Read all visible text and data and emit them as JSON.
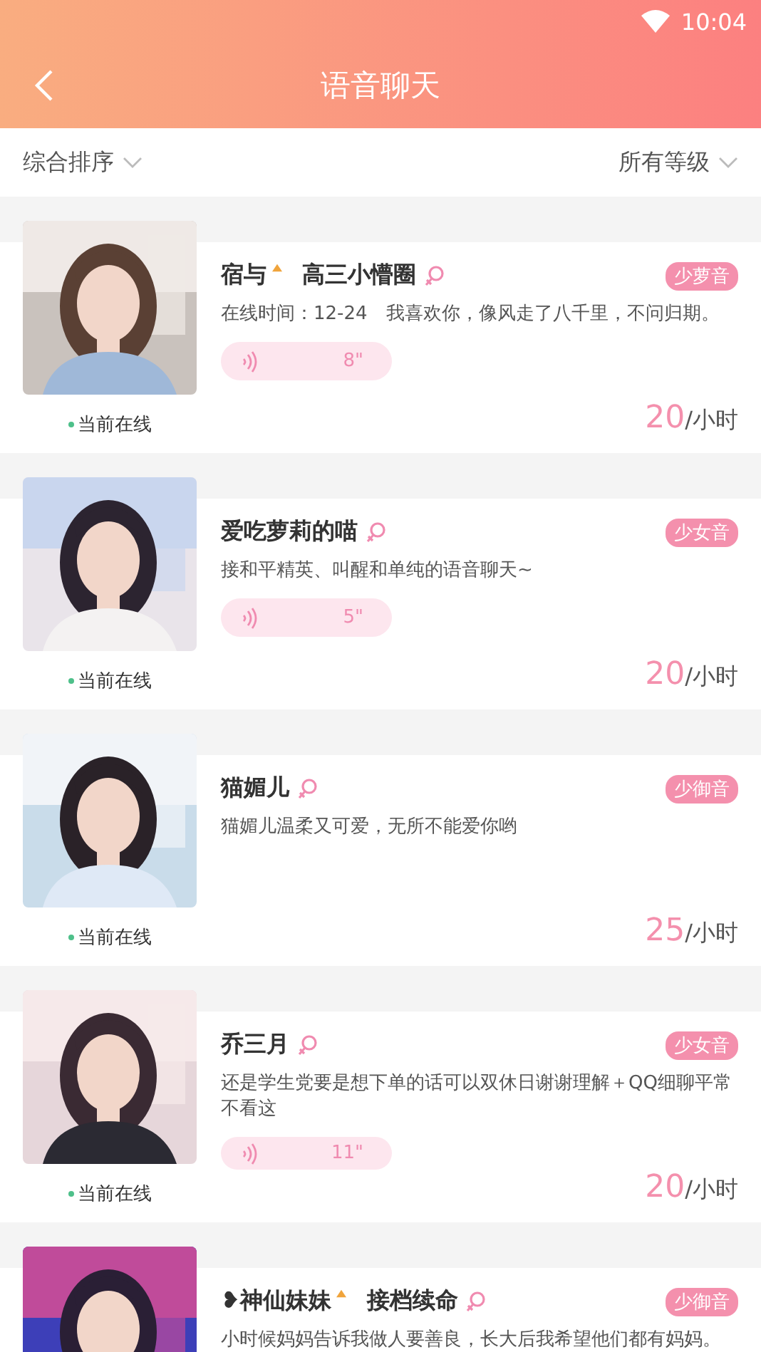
{
  "status_bar": {
    "time": "10:04"
  },
  "header": {
    "title": "语音聊天"
  },
  "filters": [
    {
      "label": "综合排序"
    },
    {
      "label": "所有等级"
    }
  ],
  "hosts": [
    {
      "name": "宿与",
      "crown": true,
      "group": "高三小懵圈",
      "tag": "少萝音",
      "bio": "在线时间：12-24　我喜欢你，像风走了八千里，不问归期。",
      "voice": "8\"",
      "online": "当前在线",
      "price": "20",
      "unit": "/小时"
    },
    {
      "name": "爱吃萝莉的喵",
      "crown": false,
      "tag": "少女音",
      "bio": "接和平精英、叫醒和单纯的语音聊天~",
      "voice": "5\"",
      "online": "当前在线",
      "price": "20",
      "unit": "/小时"
    },
    {
      "name": "猫媚儿",
      "crown": false,
      "tag": "少御音",
      "bio": "猫媚儿温柔又可爱，无所不能爱你哟",
      "online": "当前在线",
      "price": "25",
      "unit": "/小时"
    },
    {
      "name": "乔三月",
      "crown": false,
      "tag": "少女音",
      "bio": "还是学生党要是想下单的话可以双休日谢谢理解＋QQ细聊平常不看这",
      "voice": "11\"",
      "online": "当前在线",
      "price": "20",
      "unit": "/小时"
    },
    {
      "name": "❥神仙妹妹",
      "crown": true,
      "group": "接档续命",
      "tag": "少御音",
      "bio": "小时候妈妈告诉我做人要善良，长大后我希望他们都有妈妈。"
    }
  ]
}
